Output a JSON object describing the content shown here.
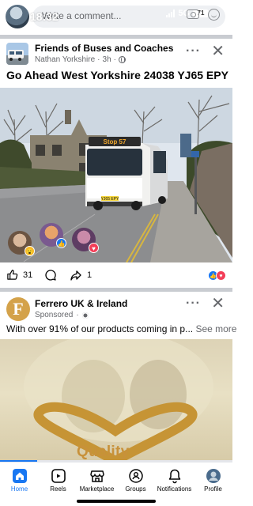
{
  "status_bar": {
    "time": "18:32",
    "network": "5G",
    "battery": "71"
  },
  "composer": {
    "placeholder": "Write a comment..."
  },
  "post": {
    "page_name": "Friends of Buses and Coaches",
    "author": "Nathan Yorkshire",
    "time": "3h",
    "title": "Go Ahead West Yorkshire  24038 YJ65 EPY",
    "photo": {
      "destination_display": "Stop 57",
      "registration_plate": "YJ65 EPY"
    },
    "like_count": "31",
    "share_count": "1",
    "colors": {
      "like": "#1877f2",
      "love": "#f33e58",
      "haha": "#f7b928"
    }
  },
  "sponsored_post": {
    "brand_name": "Ferrero UK & Ireland",
    "brand_logo_letter": "F",
    "label": "Sponsored",
    "text": "With over 91% of our products coming in p...",
    "see_more": "See more",
    "media_word": "Quality",
    "video_progress": 0.16
  },
  "bottom_nav": [
    {
      "label": "Home",
      "icon": "home-icon",
      "active": true
    },
    {
      "label": "Reels",
      "icon": "reels-icon",
      "active": false
    },
    {
      "label": "Marketplace",
      "icon": "marketplace-icon",
      "active": false
    },
    {
      "label": "Groups",
      "icon": "groups-icon",
      "active": false
    },
    {
      "label": "Notifications",
      "icon": "bell-icon",
      "active": false
    },
    {
      "label": "Profile",
      "icon": "profile-avatar",
      "active": false
    }
  ],
  "accent_color": "#1877f2"
}
